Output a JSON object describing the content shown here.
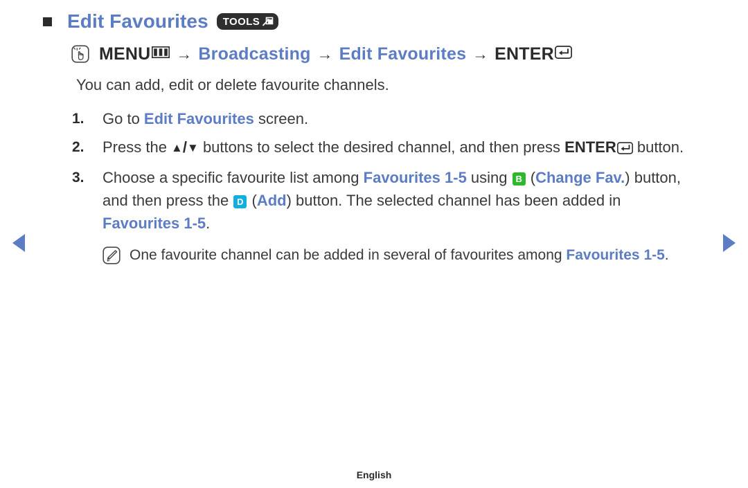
{
  "header": {
    "bullet_icon": "square-bullet-icon",
    "title": "Edit Favourites",
    "tools_badge": {
      "label": "TOOLS",
      "icon": "tools-arrow-icon"
    }
  },
  "menu_path": {
    "hand_icon": "hand-press-icon",
    "menu_label": "MENU",
    "menu_icon": "menu-bars-icon",
    "arrow_1": "→",
    "item_1": "Broadcasting",
    "arrow_2": "→",
    "item_2": "Edit Favourites",
    "arrow_3": "→",
    "enter_label": "ENTER",
    "enter_icon": "enter-return-icon"
  },
  "intro": "You can add, edit or delete favourite channels.",
  "steps": [
    {
      "number": "1.",
      "parts": [
        {
          "text": "Go to ",
          "style": "plain"
        },
        {
          "text": "Edit Favourites",
          "style": "blue"
        },
        {
          "text": " screen.",
          "style": "plain"
        }
      ]
    },
    {
      "number": "2.",
      "parts": [
        {
          "text": "Press the ",
          "style": "plain"
        },
        {
          "text": "▲",
          "style": "triangle"
        },
        {
          "text": "/",
          "style": "slash"
        },
        {
          "text": "▼",
          "style": "triangle"
        },
        {
          "text": " buttons to select the desired channel, and then press ",
          "style": "plain"
        },
        {
          "text": "ENTER",
          "style": "dark-bold"
        },
        {
          "text": "enter-return-icon",
          "style": "enter-icon"
        },
        {
          "text": " button.",
          "style": "plain"
        }
      ]
    },
    {
      "number": "3.",
      "parts": [
        {
          "text": "Choose a specific favourite list among ",
          "style": "plain"
        },
        {
          "text": "Favourites 1-5",
          "style": "blue"
        },
        {
          "text": " using ",
          "style": "plain"
        },
        {
          "text": "B",
          "style": "key-b"
        },
        {
          "text": " (",
          "style": "plain"
        },
        {
          "text": "Change Fav.",
          "style": "blue"
        },
        {
          "text": ") button, and then press the ",
          "style": "plain"
        },
        {
          "text": "D",
          "style": "key-d"
        },
        {
          "text": " (",
          "style": "plain"
        },
        {
          "text": "Add",
          "style": "blue"
        },
        {
          "text": ") button. The selected channel has been added in ",
          "style": "plain"
        },
        {
          "text": "Favourites 1-5",
          "style": "blue"
        },
        {
          "text": ".",
          "style": "plain"
        }
      ]
    }
  ],
  "note": {
    "icon": "note-pencil-icon",
    "parts": [
      {
        "text": "One favourite channel can be added in several of favourites among ",
        "style": "plain"
      },
      {
        "text": "Favourites 1-5",
        "style": "blue"
      },
      {
        "text": ".",
        "style": "plain"
      }
    ]
  },
  "navigation": {
    "prev_icon": "prev-page-arrow-icon",
    "next_icon": "next-page-arrow-icon"
  },
  "footer": {
    "language": "English"
  },
  "colors": {
    "accent_blue": "#5c7cc4",
    "text_dark": "#3a3a3a",
    "badge_b_green": "#2fb82f",
    "badge_d_cyan": "#11aee0",
    "tools_badge_bg": "#2e2e2e"
  }
}
